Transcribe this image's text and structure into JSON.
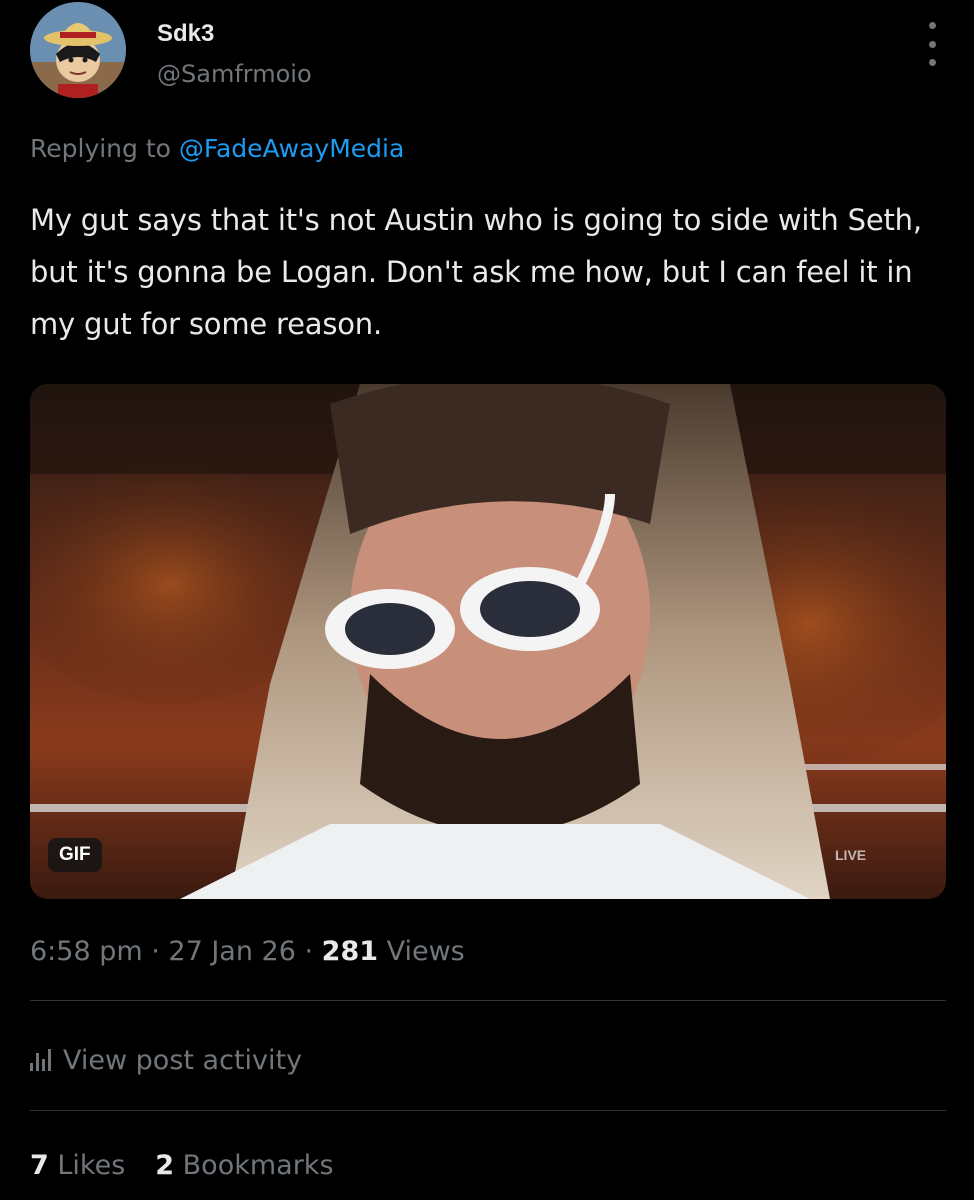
{
  "author": {
    "display_name": "Sdk3",
    "handle": "@Samfrmoio"
  },
  "reply": {
    "prefix": "Replying to ",
    "mention": "@FadeAwayMedia"
  },
  "tweet": {
    "text": "My gut says that it's not Austin who is going to side with Seth, but it's gonna be Logan. Don't ask me how, but I can feel it in my gut for some reason."
  },
  "media": {
    "badge": "GIF",
    "overlay_text": "LIVE"
  },
  "meta": {
    "time": "6:58 pm",
    "separator": " · ",
    "date": "27 Jan 26",
    "views_count": "281",
    "views_label": " Views"
  },
  "activity": {
    "label": "View post activity"
  },
  "stats": {
    "likes_count": "7",
    "likes_label": " Likes",
    "bookmarks_count": "2",
    "bookmarks_label": " Bookmarks"
  },
  "colors": {
    "background": "#000000",
    "text_primary": "#e7e9ea",
    "text_secondary": "#71767b",
    "accent": "#1d9bf0",
    "divider": "#2f3336"
  },
  "icons": {
    "more": "more-vertical-icon",
    "activity": "bar-chart-icon"
  }
}
